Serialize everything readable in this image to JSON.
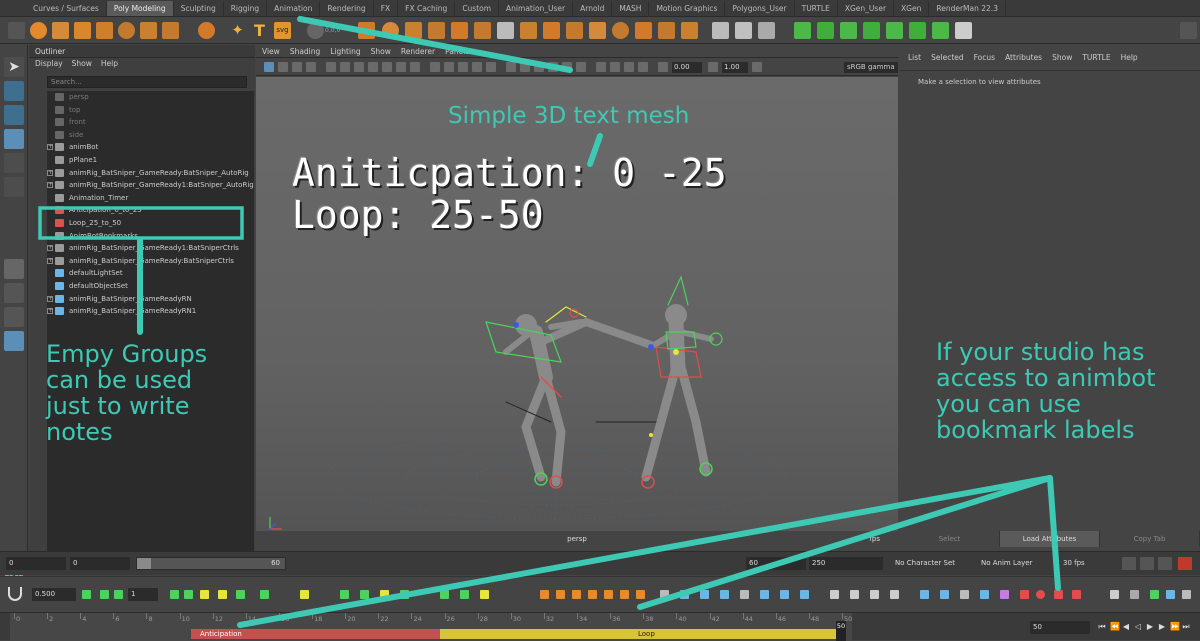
{
  "shelf": {
    "tabs": [
      "Curves / Surfaces",
      "Poly Modeling",
      "Sculpting",
      "Rigging",
      "Animation",
      "Rendering",
      "FX",
      "FX Caching",
      "Custom",
      "Animation_User",
      "Arnold",
      "MASH",
      "Motion Graphics",
      "Polygons_User",
      "TURTLE",
      "XGen_User",
      "XGen",
      "RenderMan 22.3"
    ],
    "active_tab": "Poly Modeling",
    "svg_button_label": "svg",
    "t_button_label": "T",
    "coord_label": "0,0,0"
  },
  "outliner": {
    "title": "Outliner",
    "menu": [
      "Display",
      "Show",
      "Help"
    ],
    "search_placeholder": "Search...",
    "items": [
      {
        "label": "persp",
        "muted": true,
        "expand": false
      },
      {
        "label": "top",
        "muted": true,
        "expand": false
      },
      {
        "label": "front",
        "muted": true,
        "expand": false
      },
      {
        "label": "side",
        "muted": true,
        "expand": false
      },
      {
        "label": "animBot",
        "muted": false,
        "expand": true
      },
      {
        "label": "pPlane1",
        "muted": false,
        "expand": false
      },
      {
        "label": "animRig_BatSniper_GameReady:BatSniper_AutoRig",
        "muted": false,
        "expand": true
      },
      {
        "label": "animRig_BatSniper_GameReady1:BatSniper_AutoRig",
        "muted": false,
        "expand": true
      },
      {
        "label": "Animation_Timer",
        "muted": false,
        "expand": false
      },
      {
        "label": "Anticipation_0_to_25",
        "muted": false,
        "expand": false
      },
      {
        "label": "Loop_25_to_50",
        "muted": false,
        "expand": false
      },
      {
        "label": "AnimBotBookmarks",
        "muted": false,
        "expand": false
      },
      {
        "label": "animRig_BatSniper_GameReady1:BatSniperCtrls",
        "muted": false,
        "expand": true
      },
      {
        "label": "animRig_BatSniper_GameReady:BatSniperCtrls",
        "muted": false,
        "expand": true
      },
      {
        "label": "defaultLightSet",
        "muted": false,
        "expand": false
      },
      {
        "label": "defaultObjectSet",
        "muted": false,
        "expand": false
      },
      {
        "label": "animRig_BatSniper_GameReadyRN",
        "muted": false,
        "expand": true
      },
      {
        "label": "animRig_BatSniper_GameReadyRN1",
        "muted": false,
        "expand": true
      }
    ]
  },
  "viewport": {
    "menu": [
      "View",
      "Shading",
      "Lighting",
      "Show",
      "Renderer",
      "Panels"
    ],
    "value1": "0.00",
    "value2": "1.00",
    "gamma": "sRGB gamma",
    "camera_label": "persp",
    "fps_label": "fps",
    "text_mesh_line1": "Aniticpation: 0 -25",
    "text_mesh_line2": "Loop: 25-50"
  },
  "attribute_editor": {
    "menu": [
      "List",
      "Selected",
      "Focus",
      "Attributes",
      "Show",
      "TURTLE",
      "Help"
    ],
    "message": "Make a selection to view attributes",
    "buttons": [
      "Select",
      "Load Attributes",
      "Copy Tab"
    ]
  },
  "range": {
    "start": "0",
    "inner_start": "0",
    "slider_value": "60",
    "inner_end": "60",
    "end": "250",
    "character_set": "No Character Set",
    "anim_layer": "No Anim Layer",
    "fps": "30 fps"
  },
  "toolrow": {
    "value1": "0.500",
    "value2": "1"
  },
  "timeline": {
    "ticks": [
      "0",
      "2",
      "4",
      "6",
      "8",
      "10",
      "12",
      "14",
      "16",
      "18",
      "20",
      "22",
      "24",
      "26",
      "28",
      "30",
      "32",
      "34",
      "36",
      "38",
      "40",
      "42",
      "44",
      "46",
      "48",
      "50"
    ],
    "current_frame": "50",
    "frame_field": "50",
    "bookmarks": [
      {
        "label": "Anticipation",
        "start": 6,
        "end": 25,
        "color": "#d9534f"
      },
      {
        "label": "Loop",
        "start": 25,
        "end": 50,
        "color": "#e8d23a"
      }
    ]
  },
  "annotations": {
    "text_mesh": "Simple 3D text mesh",
    "groups": [
      "Empy Groups",
      "can be used",
      "just to write",
      "notes"
    ],
    "animbot": [
      "If your studio has",
      "access to animbot",
      "you can use",
      "bookmark labels"
    ],
    "accent_color": "#3ec9b4"
  }
}
